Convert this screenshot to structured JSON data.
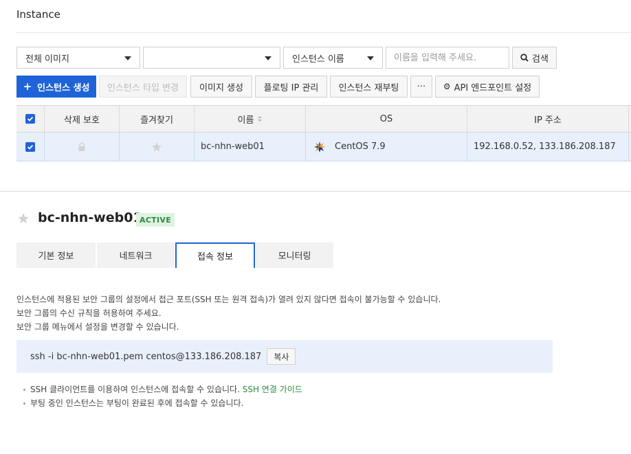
{
  "page": {
    "title": "Instance"
  },
  "filters": {
    "image_select": "전체 이미지",
    "second_select": "",
    "field_select": "인스턴스 이름",
    "search_placeholder": "이름을 입력해 주세요.",
    "search_label": "검색"
  },
  "toolbar": {
    "create": "인스턴스 생성",
    "change_type": "인스턴스 타입 변경",
    "create_image": "이미지 생성",
    "floating_ip": "플로팅 IP 관리",
    "reboot": "인스턴스 재부팅",
    "more": "···",
    "api_endpoint": "API 엔드포인트 설정"
  },
  "table": {
    "columns": [
      "삭제 보호",
      "즐겨찾기",
      "이름",
      "OS",
      "IP 주소"
    ],
    "rows": [
      {
        "name": "bc-nhn-web01",
        "os": "CentOS 7.9",
        "ip": "192.168.0.52, 133.186.208.187",
        "selected": true
      }
    ]
  },
  "detail": {
    "name": "bc-nhn-web01",
    "status": "ACTIVE",
    "tabs": [
      "기본 정보",
      "네트워크",
      "접속 정보",
      "모니터링"
    ],
    "active_tab": "접속 정보",
    "notice": [
      "인스턴스에 적용된 보안 그룹의 설정에서 접근 포트(SSH 또는 원격 접속)가 열려 있지 않다면 접속이 불가능할 수 있습니다.",
      "보안 그룹의 수신 규칙을 허용하여 주세요.",
      "보안 그룹 메뉴에서 설정을 변경할 수 있습니다."
    ],
    "ssh_command": "ssh -i bc-nhn-web01.pem centos@133.186.208.187",
    "copy_label": "복사",
    "guide_1": "SSH 클라이언트를 이용하여 인스턴스에 접속할 수 있습니다.",
    "guide_link": "SSH 연결 가이드",
    "guide_2": "부팅 중인 인스턴스는 부팅이 완료된 후에 접속할 수 있습니다."
  },
  "colors": {
    "primary": "#1f63d8",
    "row_selected": "#e8f0fb",
    "status_green": "#2e8a3d"
  }
}
